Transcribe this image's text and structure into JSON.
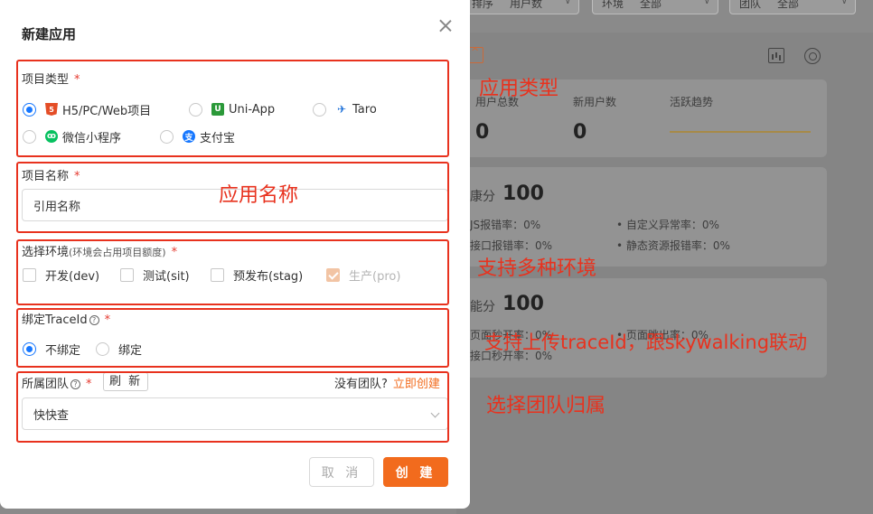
{
  "background": {
    "filters": [
      {
        "label": "排序",
        "value": "用户数"
      },
      {
        "label": "环境",
        "value": "全部"
      },
      {
        "label": "团队",
        "value": "全部"
      }
    ],
    "stats": [
      {
        "label": "用户总数",
        "value": "0"
      },
      {
        "label": "新用户数",
        "value": "0"
      },
      {
        "label": "活跃趋势"
      }
    ],
    "health": {
      "title": "康分",
      "score": "100",
      "items": [
        "JS报错率：0%",
        "接口报错率：0%",
        "自定义异常率：0%",
        "静态资源报错率：0%"
      ]
    },
    "performance": {
      "title": "能分",
      "score": "100",
      "items": [
        "页面秒开率：0%",
        "接口秒开率：0%",
        "页面跳出率：0%"
      ]
    }
  },
  "modal": {
    "title": "新建应用",
    "project_type": {
      "label": "项目类型",
      "options": [
        {
          "label": "H5/PC/Web项目",
          "icon": "html5-icon",
          "selected": true
        },
        {
          "label": "Uni-App",
          "icon": "uniapp-icon",
          "selected": false
        },
        {
          "label": "Taro",
          "icon": "taro-icon",
          "selected": false
        },
        {
          "label": "微信小程序",
          "icon": "wechat-mini-icon",
          "selected": false
        },
        {
          "label": "支付宝",
          "icon": "alipay-icon",
          "selected": false
        }
      ]
    },
    "project_name": {
      "label": "项目名称",
      "value": "引用名称"
    },
    "environment": {
      "label": "选择环境",
      "sub": "(环境会占用项目额度)",
      "options": [
        {
          "label": "开发(dev)",
          "checked": false,
          "disabled": false
        },
        {
          "label": "测试(sit)",
          "checked": false,
          "disabled": false
        },
        {
          "label": "预发布(stag)",
          "checked": false,
          "disabled": false
        },
        {
          "label": "生产(pro)",
          "checked": true,
          "disabled": true
        }
      ]
    },
    "traceid": {
      "label": "绑定TraceId",
      "options": [
        {
          "label": "不绑定",
          "selected": true
        },
        {
          "label": "绑定",
          "selected": false
        }
      ]
    },
    "team": {
      "label": "所属团队",
      "refresh_label": "刷 新",
      "no_team_text": "没有团队?",
      "create_link": "立即创建",
      "value": "快快查"
    },
    "cancel_label": "取 消",
    "create_label": "创 建",
    "required_mark": "*"
  },
  "annotations": {
    "app_type": "应用类型",
    "app_name": "应用名称",
    "multi_env": "支持多种环境",
    "traceid": "支持上传traceId，跟skywalking联动",
    "team": "选择团队归属"
  },
  "colors": {
    "primary": "#1677ff",
    "accent": "#f26b1d",
    "annotation": "#e8321e"
  }
}
